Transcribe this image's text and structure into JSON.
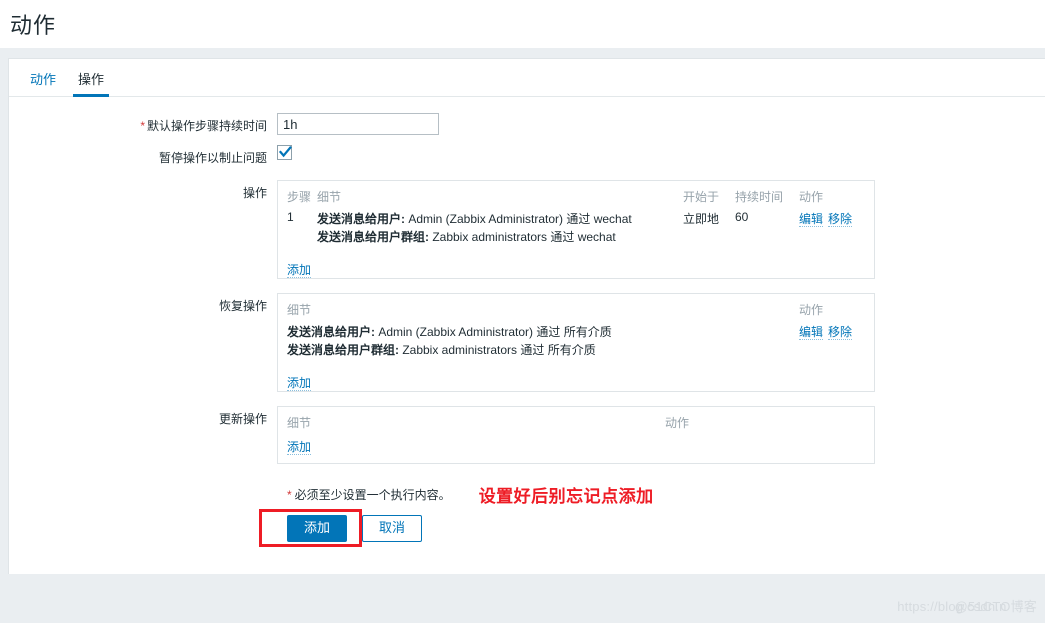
{
  "header": {
    "title": "动作"
  },
  "tabs": [
    {
      "label": "动作",
      "active": false
    },
    {
      "label": "操作",
      "active": true
    }
  ],
  "form": {
    "default_duration": {
      "label": "默认操作步骤持续时间",
      "required": true,
      "value": "1h",
      "placeholder": ""
    },
    "pause_suppressed": {
      "label": "暂停操作以制止问题",
      "checked": true
    },
    "operations": {
      "label": "操作",
      "columns": [
        "步骤",
        "细节",
        "开始于",
        "持续时间",
        "动作"
      ],
      "rows": [
        {
          "step": "1",
          "details": [
            {
              "bold": "发送消息给用户:",
              "rest": " Admin (Zabbix Administrator) 通过 wechat"
            },
            {
              "bold": "发送消息给用户群组:",
              "rest": " Zabbix administrators 通过 wechat"
            }
          ],
          "start": "立即地",
          "duration": "60",
          "actions": [
            "编辑",
            "移除"
          ]
        }
      ],
      "add_label": "添加"
    },
    "recovery_operations": {
      "label": "恢复操作",
      "columns": [
        "细节",
        "动作"
      ],
      "rows": [
        {
          "details": [
            {
              "bold": "发送消息给用户:",
              "rest": " Admin (Zabbix Administrator) 通过 所有介质"
            },
            {
              "bold": "发送消息给用户群组:",
              "rest": " Zabbix administrators 通过 所有介质"
            }
          ],
          "actions": [
            "编辑",
            "移除"
          ]
        }
      ],
      "add_label": "添加"
    },
    "update_operations": {
      "label": "更新操作",
      "columns": [
        "细节",
        "动作"
      ],
      "rows": [],
      "add_label": "添加"
    }
  },
  "footnote": {
    "star": "*",
    "text": "必须至少设置一个执行内容。"
  },
  "annotation": "设置好后别忘记点添加",
  "buttons": {
    "submit": "添加",
    "cancel": "取消"
  },
  "watermark": {
    "text1": "https://blog.csdn.n",
    "text2": "@51CTO博客"
  },
  "colors": {
    "accent": "#0275b8",
    "danger": "#ee1c25",
    "required": "#d23b3b",
    "muted": "#97a3ab",
    "page_bg": "#eaeef1"
  }
}
